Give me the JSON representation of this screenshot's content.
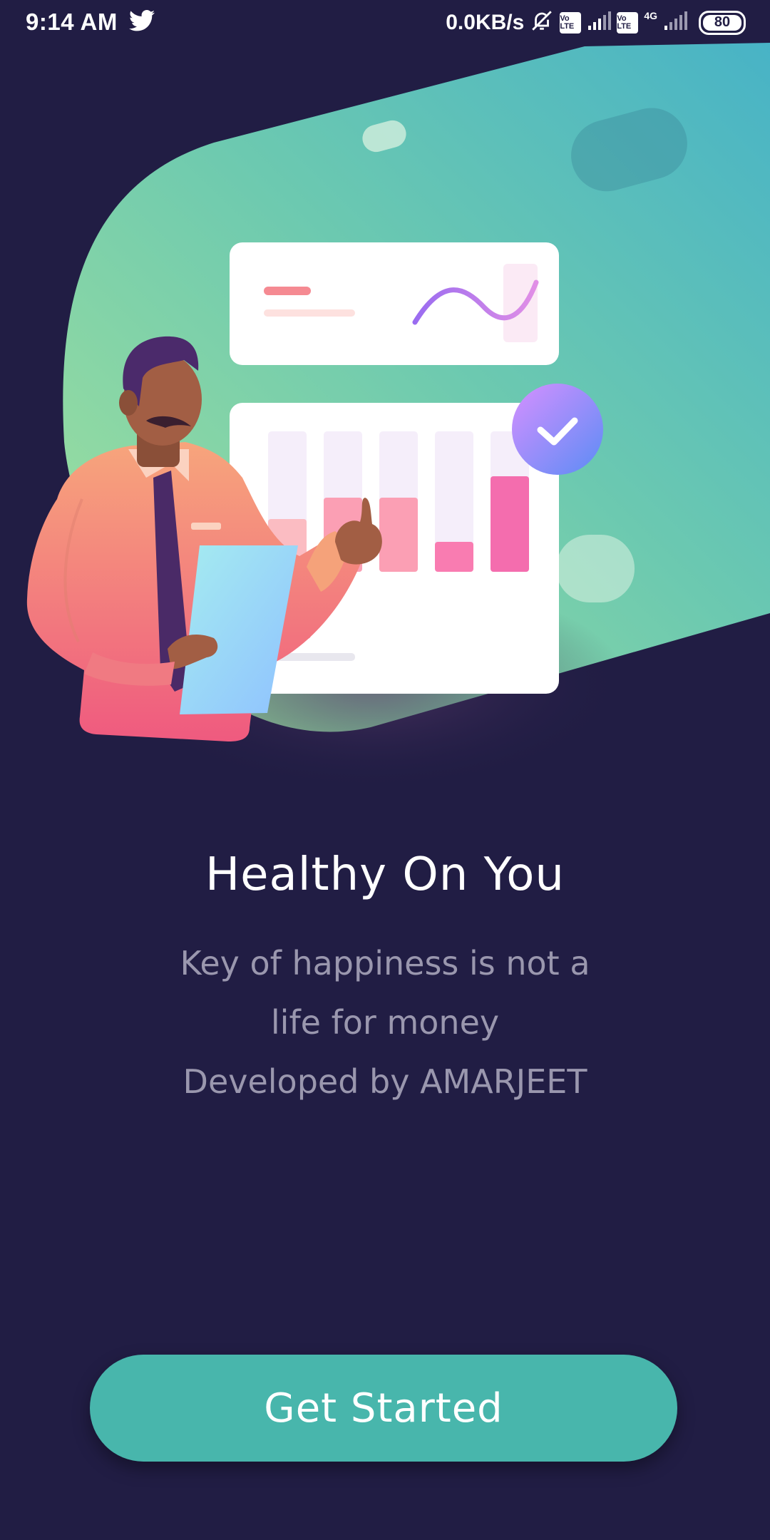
{
  "status_bar": {
    "time": "9:14 AM",
    "net_speed": "0.0KB/s",
    "volte_label_1": "Vo LTE",
    "volte_label_2": "Vo LTE",
    "network_type": "4G",
    "battery_level": "80"
  },
  "onboarding": {
    "title": "Healthy On You",
    "subtitle_lines": [
      "Key of happiness is not a",
      "life for money",
      "Developed by AMARJEET"
    ],
    "cta_label": "Get Started"
  },
  "colors": {
    "background": "#211d44",
    "accent": "#48b6ac",
    "blob_gradient_start": "#a6e39b",
    "blob_gradient_end": "#4bb3c4"
  }
}
